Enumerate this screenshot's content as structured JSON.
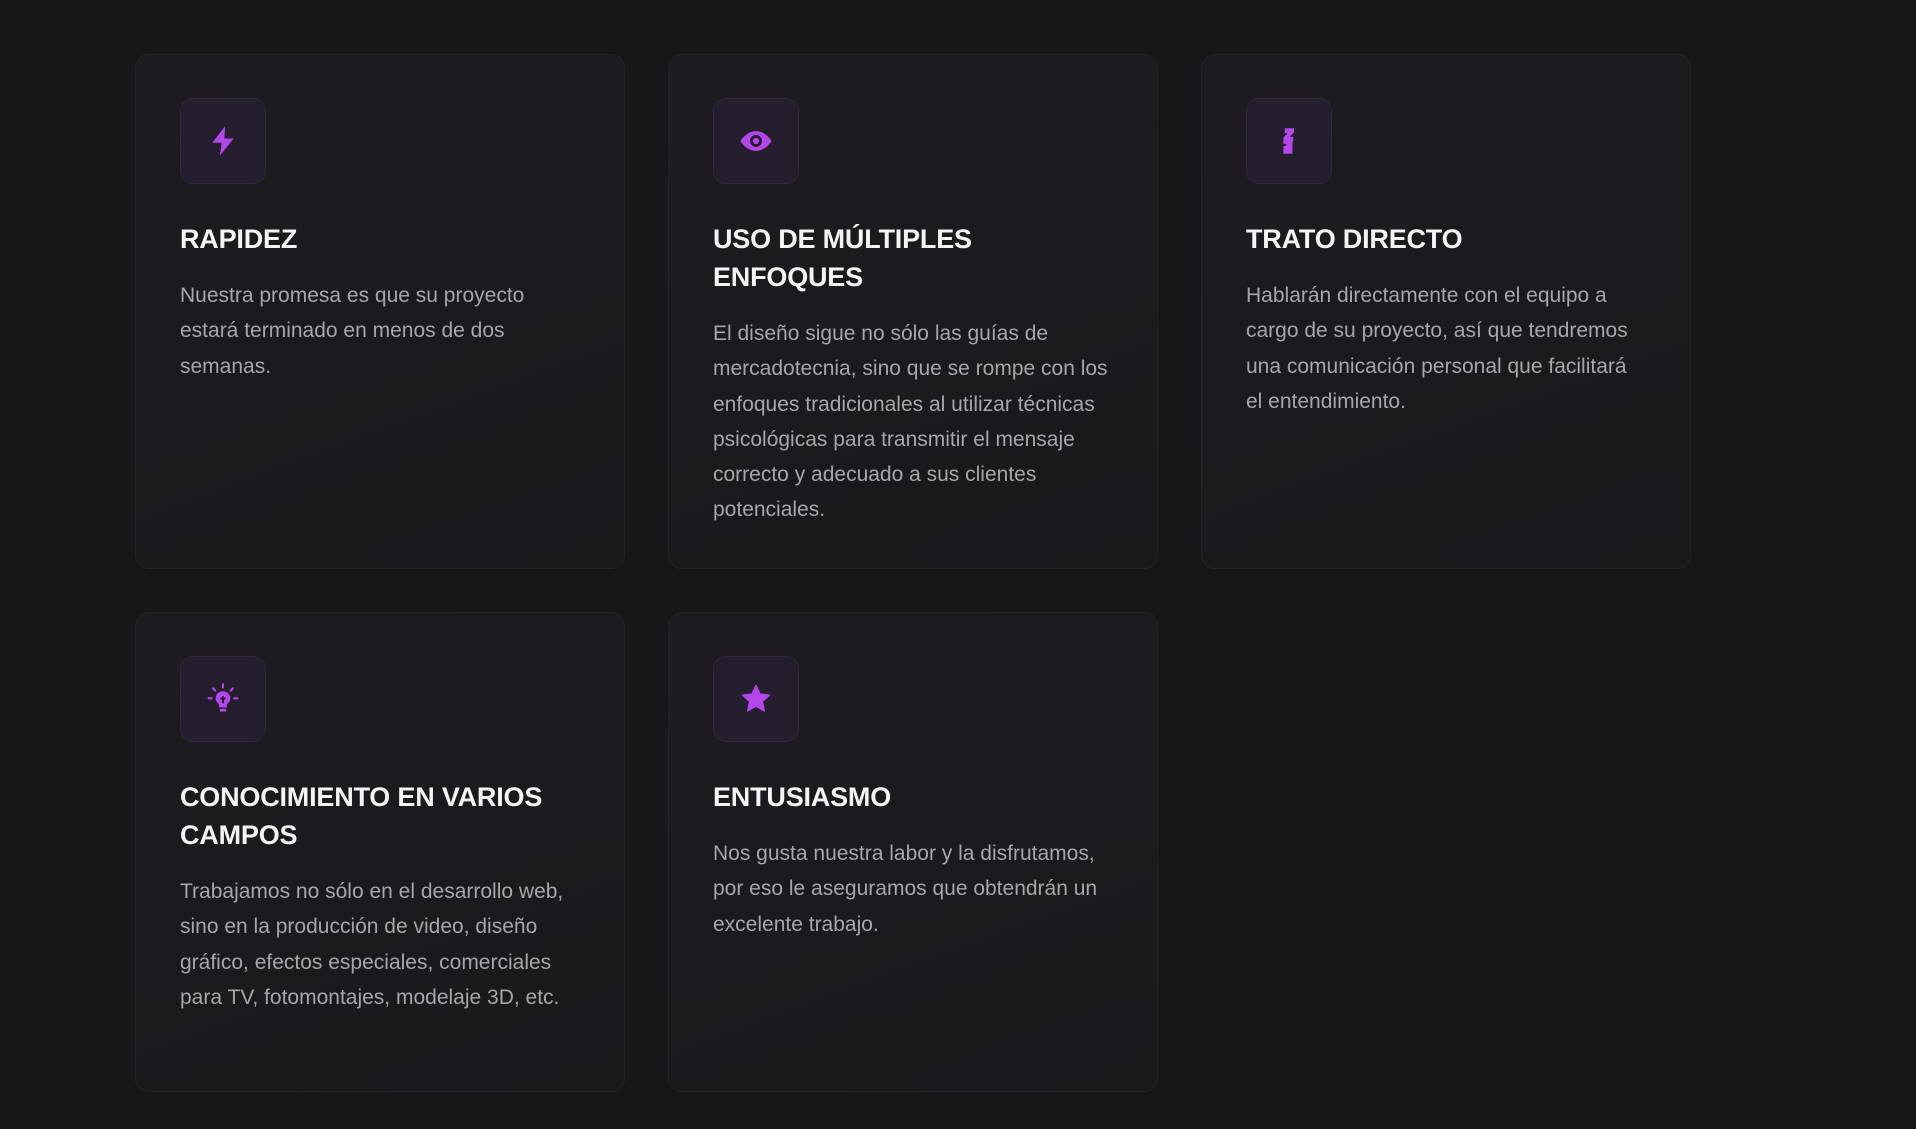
{
  "accent_color": "#b347ea",
  "features": [
    {
      "icon": "bolt-icon",
      "title": "RAPIDEZ",
      "description": "Nuestra promesa es que su proyecto estará terminado en menos de dos semanas."
    },
    {
      "icon": "eye-icon",
      "title": "USO DE MÚLTIPLES ENFOQUES",
      "description": "El diseño sigue no sólo las guías de mercadotecnia, sino que se rompe con los enfoques tradicionales al utilizar técnicas psicológicas para transmitir el mensaje correcto y adecuado a sus clientes potenciales."
    },
    {
      "icon": "handshake-icon",
      "title": "TRATO DIRECTO",
      "description": "Hablarán directamente con el equipo a cargo de su proyecto, así que tendremos una comunicación personal que facilitará el entendimiento."
    },
    {
      "icon": "lightbulb-icon",
      "title": "CONOCIMIENTO EN VARIOS CAMPOS",
      "description": "Trabajamos no sólo en el desarrollo web, sino en la producción de video, diseño gráfico, efectos especiales, comerciales para TV, fotomontajes, modelaje 3D, etc."
    },
    {
      "icon": "star-icon",
      "title": "ENTUSIASMO",
      "description": "Nos gusta nuestra labor y la disfrutamos, por eso le aseguramos que obtendrán un excelente trabajo."
    }
  ]
}
